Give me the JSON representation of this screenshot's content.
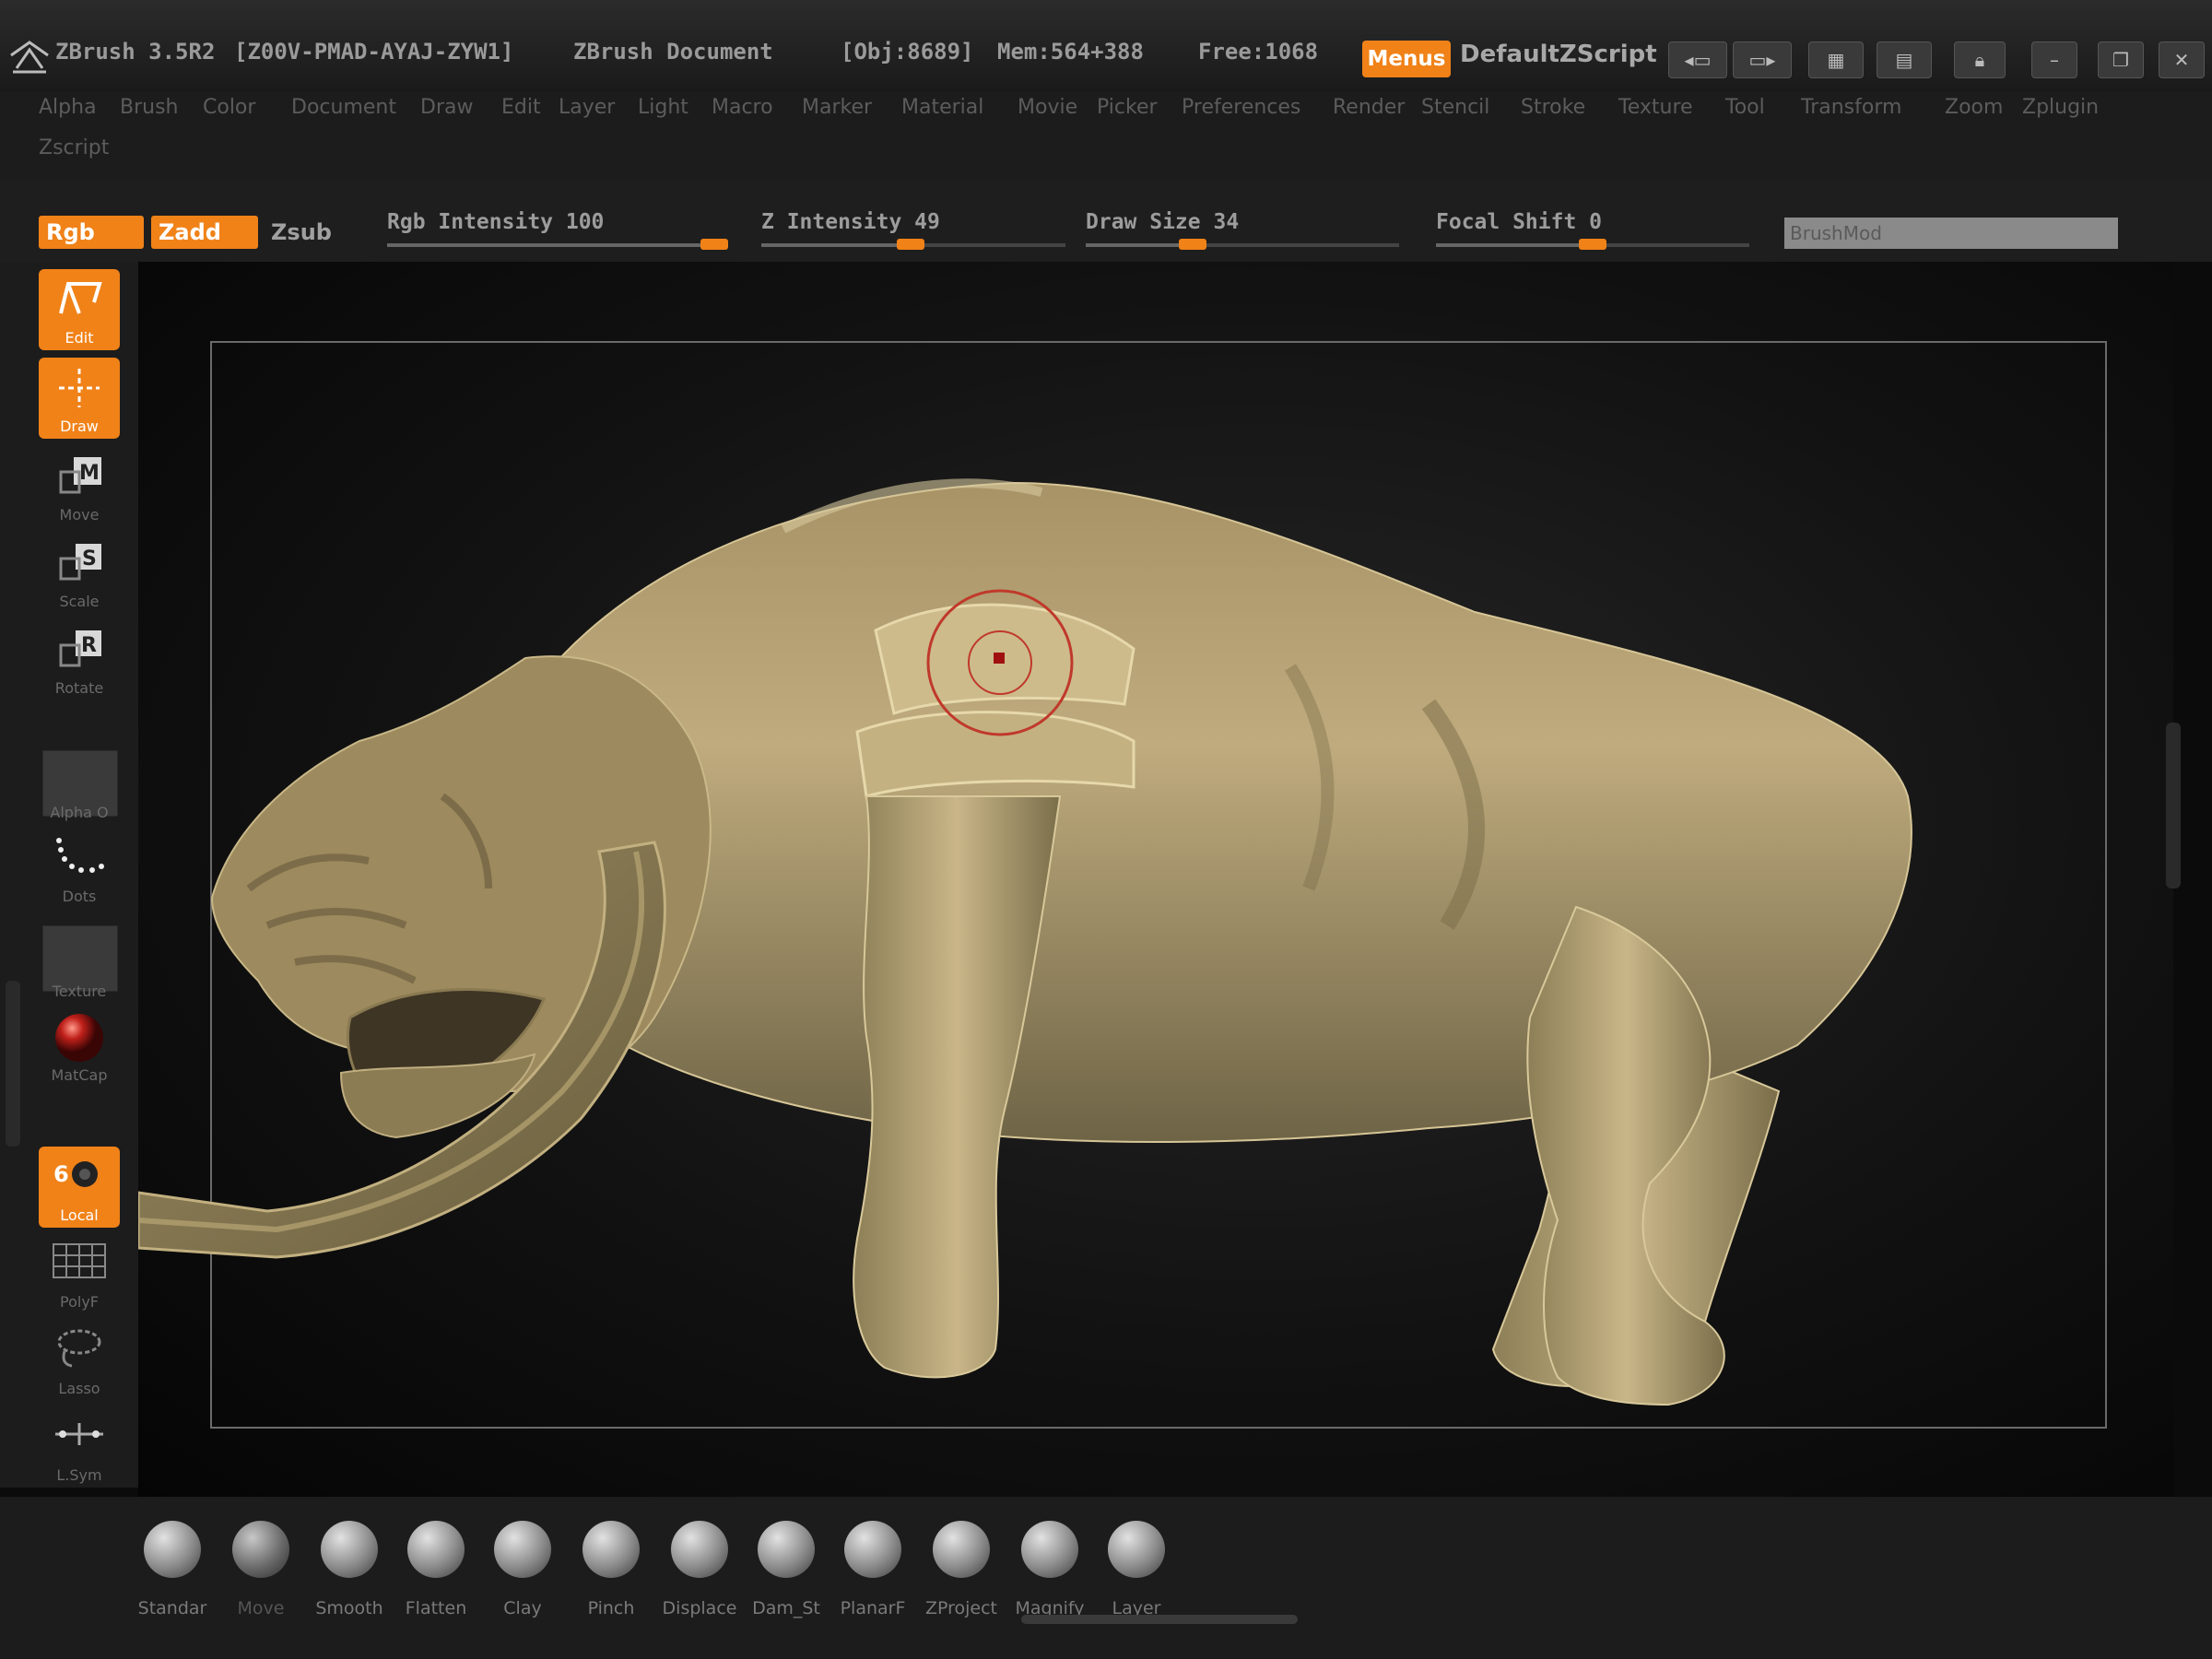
{
  "titlebar": {
    "app_name": "ZBrush 3.5R2",
    "serial": "[Z00V-PMAD-AYAJ-ZYW1]",
    "document": "ZBrush Document",
    "obj": "[Obj:8689]",
    "mem": "Mem:564+388",
    "free": "Free:1068",
    "menus_label": "Menus",
    "script_label": "DefaultZScript"
  },
  "menu": {
    "row1": [
      "Alpha",
      "Brush",
      "Color",
      "Document",
      "Draw",
      "Edit",
      "Layer",
      "Light",
      "Macro",
      "Marker",
      "Material",
      "Movie",
      "Picker",
      "Preferences",
      "Render",
      "Stencil",
      "Stroke",
      "Texture",
      "Tool",
      "Transform",
      "Zoom",
      "Zplugin"
    ],
    "row2": [
      "Zscript"
    ]
  },
  "topshelf": {
    "rgb_label": "Rgb",
    "zadd_label": "Zadd",
    "zsub_label": "Zsub",
    "rgb_intensity": {
      "label": "Rgb Intensity 100",
      "value": 100,
      "max": 100
    },
    "z_intensity": {
      "label": "Z Intensity 49",
      "value": 49,
      "max": 100
    },
    "draw_size": {
      "label": "Draw Size 34",
      "value": 34,
      "max": 100
    },
    "focal_shift": {
      "label": "Focal Shift 0",
      "value": 0,
      "min": -100,
      "max": 100
    },
    "brush_field": "BrushMod"
  },
  "leftshelf": {
    "edit": "Edit",
    "draw": "Draw",
    "move": "Move",
    "scale": "Scale",
    "rotate": "Rotate",
    "alpha": "Alpha O",
    "dots": "Dots",
    "texture": "Texture",
    "matcap": "MatCap",
    "local": "Local",
    "polyf": "PolyF",
    "lasso": "Lasso",
    "lsym": "L.Sym"
  },
  "brushes": [
    "Standar",
    "Move",
    "Smooth",
    "Flatten",
    "Clay",
    "Pinch",
    "Displace",
    "Dam_St",
    "PlanarF",
    "ZProject",
    "Magnify",
    "Layer"
  ],
  "colors": {
    "accent": "#f08218",
    "model": "#b8a274",
    "cursor": "#c0392b"
  }
}
